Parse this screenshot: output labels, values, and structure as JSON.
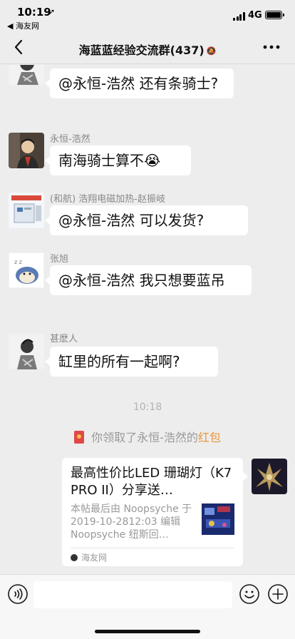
{
  "status_bar": {
    "time": "10:19",
    "location_arrow": "➚",
    "back_app": "◀ 海友网",
    "network": "4G"
  },
  "nav": {
    "title": "海蓝蓝经验交流群(437)",
    "mute_icon": "🔕"
  },
  "messages": [
    {
      "sender": "",
      "text": "@永恒-浩然 还有条骑士?"
    },
    {
      "sender": "永恒-浩然",
      "text": "南海骑士算不",
      "emoji": "😭"
    },
    {
      "sender": "(和航) 浩翔电磁加热-赵振岐",
      "text": "@永恒-浩然 可以发货?"
    },
    {
      "sender": "张旭",
      "text": "@永恒-浩然 我只想要蓝吊"
    },
    {
      "sender": "甚麽人",
      "text": "缸里的所有一起啊?"
    }
  ],
  "timestamp": "10:18",
  "system": {
    "prefix": "你领取了永恒-浩然的",
    "accent": "红包"
  },
  "card": {
    "title": "最高性价比LED 珊瑚灯（K7 PRO II）分享送…",
    "desc": "本帖最后由 Noopsyche 于 2019-10-2812:03 编辑 Noopsyche 纽斯回…",
    "source": "海友网"
  },
  "input": {
    "placeholder": ""
  },
  "colors": {
    "accent": "#e9963a",
    "background": "#ededed",
    "bubble": "#ffffff"
  }
}
